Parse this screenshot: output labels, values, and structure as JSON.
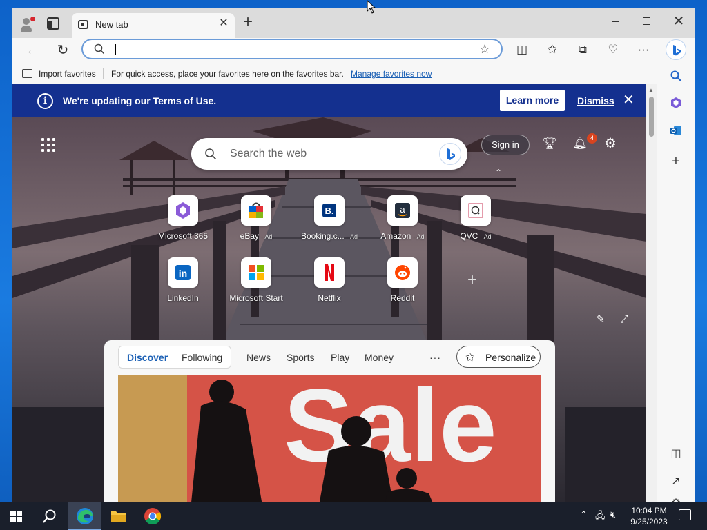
{
  "browser": {
    "tab_title": "New tab",
    "address_value": "",
    "favorites_bar": {
      "import_label": "Import favorites",
      "message": "For quick access, place your favorites here on the favorites bar.",
      "manage_link": "Manage favorites now"
    }
  },
  "banner": {
    "text": "We're updating our Terms of Use.",
    "learn_more": "Learn more",
    "dismiss": "Dismiss"
  },
  "newtab": {
    "search_placeholder": "Search the web",
    "sign_in": "Sign in",
    "notification_count": "4",
    "quick_links": [
      {
        "label": "Microsoft 365",
        "ad": ""
      },
      {
        "label": "eBay",
        "ad": "· Ad"
      },
      {
        "label": "Booking.c...",
        "ad": "· Ad"
      },
      {
        "label": "Amazon",
        "ad": "· Ad"
      },
      {
        "label": "QVC",
        "ad": "· Ad"
      },
      {
        "label": "LinkedIn",
        "ad": ""
      },
      {
        "label": "Microsoft Start",
        "ad": ""
      },
      {
        "label": "Netflix",
        "ad": ""
      },
      {
        "label": "Reddit",
        "ad": ""
      }
    ]
  },
  "feed": {
    "tabs": [
      "Discover",
      "Following",
      "News",
      "Sports",
      "Play",
      "Money"
    ],
    "more": "···",
    "personalize": "Personalize",
    "image_text": "Sale"
  },
  "taskbar": {
    "time": "10:04 PM",
    "date": "9/25/2023"
  },
  "colors": {
    "banner": "#14308f",
    "accent": "#1a5fb4"
  }
}
